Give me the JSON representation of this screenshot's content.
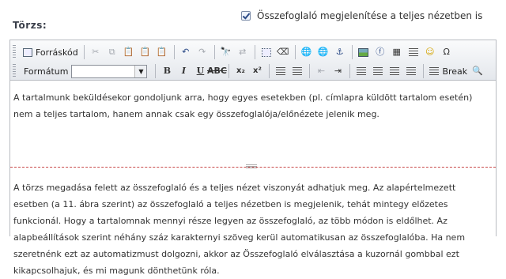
{
  "section_label": "Törzs:",
  "summary_toggle": {
    "label": "Összefoglaló megjelenítése a teljes nézetben is",
    "checked": true
  },
  "toolbar": {
    "source_label": "Forráskód",
    "format_label": "Formátum",
    "format_value": "",
    "bold": "B",
    "italic": "I",
    "underline": "U",
    "strike": "ABC",
    "subscript": "x₂",
    "superscript": "x²",
    "break_label": "Break",
    "icons_row1": [
      "source-icon",
      "cut-icon",
      "copy-icon",
      "paste-icon",
      "paste-text-icon",
      "paste-word-icon",
      "undo-icon",
      "redo-icon",
      "find-icon",
      "replace-icon",
      "select-all-icon",
      "remove-format-icon",
      "link-icon",
      "unlink-icon",
      "anchor-icon",
      "image-icon",
      "flash-icon",
      "table-icon",
      "horizontal-rule-icon",
      "smiley-icon",
      "special-char-icon"
    ],
    "icons_row2": [
      "bold-icon",
      "italic-icon",
      "underline-icon",
      "strike-icon",
      "subscript-icon",
      "superscript-icon",
      "numbered-list-icon",
      "bulleted-list-icon",
      "outdent-icon",
      "indent-icon",
      "align-left-icon",
      "align-center-icon",
      "align-right-icon",
      "justify-icon",
      "page-break-icon",
      "preview-icon"
    ]
  },
  "content": {
    "summary_text": "A tartalmunk beküldésekor gondoljunk arra, hogy egyes esetekben (pl. címlapra küldött tartalom esetén) nem a teljes tartalom, hanem annak csak egy összefoglalója/előnézete jelenik meg.",
    "body_text": "A törzs megadása felett az összefoglaló és a teljes nézet viszonyát adhatjuk meg. Az alapértelmezett esetben (a 11. ábra szerint) az összefoglaló a teljes nézetben is megjelenik, tehát mintegy előzetes funkcionál. Hogy a tartalomnak mennyi része legyen az összefoglaló, az több módon is eldőlhet. Az alapbeállítások szerint néhány száz karakternyi szöveg kerül automatikusan az összefoglalóba. Ha nem szeretnénk ezt az automatizmust dolgozni, akkor az Összefoglaló elválasztása a kuzornál gombbal ezt kikapcsolhajuk, és mi magunk dönthetünk róla."
  }
}
